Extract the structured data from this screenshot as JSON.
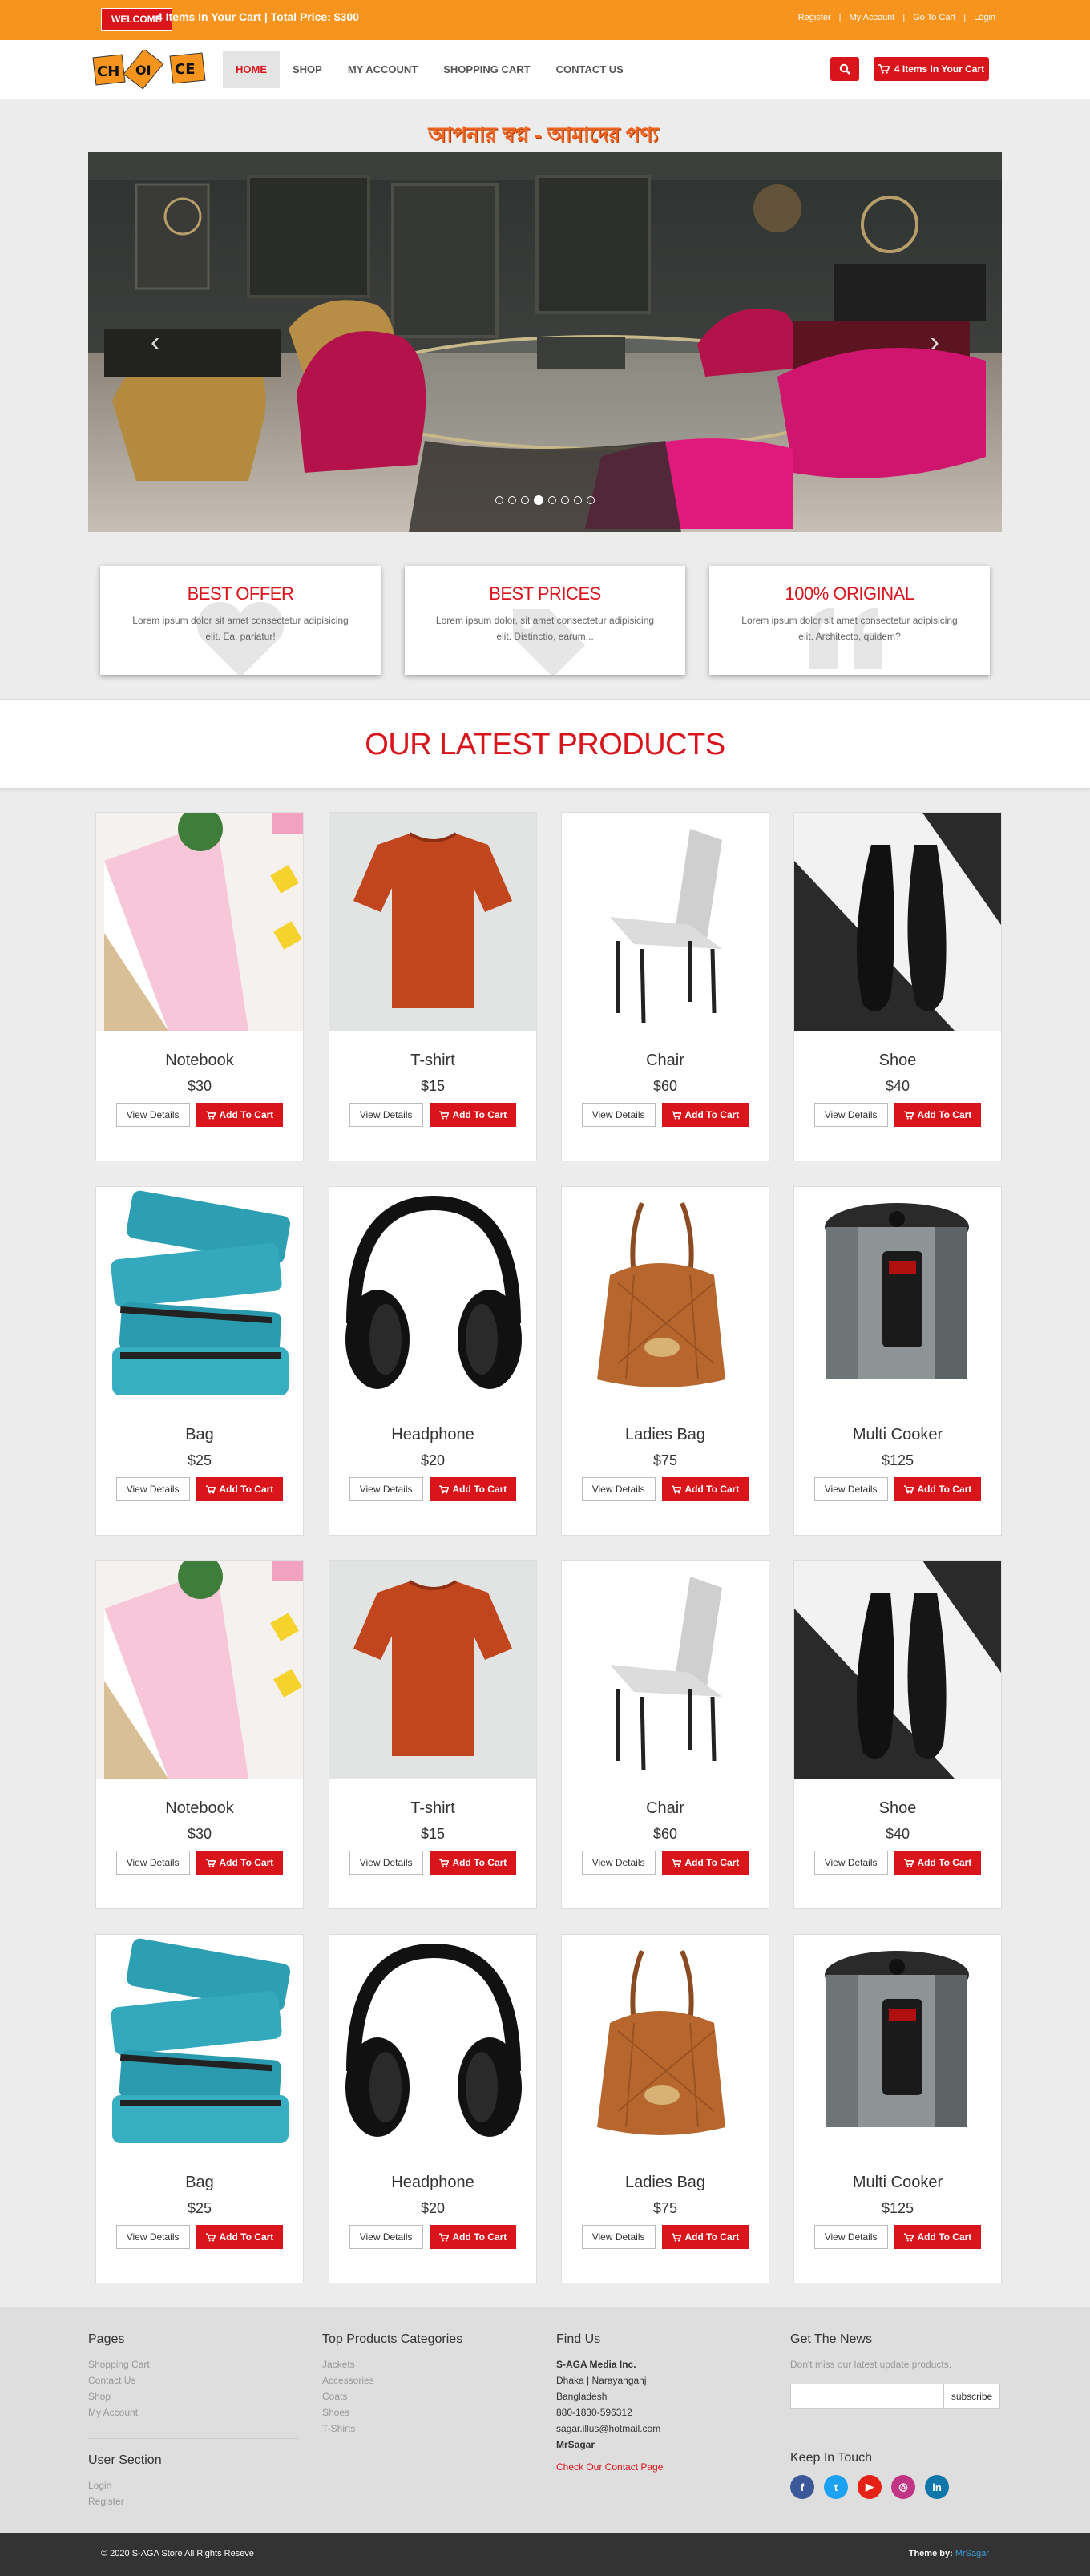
{
  "topbar": {
    "welcome": "WELCOME",
    "cart_info": "4 Items In Your Cart | Total Price: $300",
    "links": [
      "Register",
      "My Account",
      "Go To Cart",
      "Login"
    ]
  },
  "brand": {
    "logo_text": [
      "CH",
      "OI",
      "CE"
    ]
  },
  "nav": {
    "items": [
      "HOME",
      "SHOP",
      "MY ACCOUNT",
      "SHOPPING CART",
      "CONTACT US"
    ],
    "active": "HOME",
    "cart_button": "4 Items In Your Cart"
  },
  "hero": {
    "tagline": "আপনার স্বপ্ন - আমাদের পণ্য",
    "dots_count": 8,
    "active_dot": 3
  },
  "features": [
    {
      "title": "BEST OFFER",
      "text": "Lorem ipsum dolor sit amet consectetur adipisicing elit. Ea, pariatur!"
    },
    {
      "title": "BEST PRICES",
      "text": "Lorem ipsum dolor, sit amet consectetur adipisicing elit. Distinctio, earum..."
    },
    {
      "title": "100% ORIGINAL",
      "text": "Lorem ipsum dolor sit amet consectetur adipisicing elit. Architecto, quidem?"
    }
  ],
  "section_title": "OUR LATEST PRODUCTS",
  "product_buttons": {
    "view": "View Details",
    "add": "Add To Cart"
  },
  "products": [
    {
      "name": "Notebook",
      "price": "$30",
      "kind": "notebook"
    },
    {
      "name": "T-shirt",
      "price": "$15",
      "kind": "tshirt"
    },
    {
      "name": "Chair",
      "price": "$60",
      "kind": "chair"
    },
    {
      "name": "Shoe",
      "price": "$40",
      "kind": "shoe"
    },
    {
      "name": "Bag",
      "price": "$25",
      "kind": "bag"
    },
    {
      "name": "Headphone",
      "price": "$20",
      "kind": "headphone"
    },
    {
      "name": "Ladies Bag",
      "price": "$75",
      "kind": "ladiesbag"
    },
    {
      "name": "Multi Cooker",
      "price": "$125",
      "kind": "cooker"
    },
    {
      "name": "Notebook",
      "price": "$30",
      "kind": "notebook"
    },
    {
      "name": "T-shirt",
      "price": "$15",
      "kind": "tshirt"
    },
    {
      "name": "Chair",
      "price": "$60",
      "kind": "chair"
    },
    {
      "name": "Shoe",
      "price": "$40",
      "kind": "shoe"
    },
    {
      "name": "Bag",
      "price": "$25",
      "kind": "bag"
    },
    {
      "name": "Headphone",
      "price": "$20",
      "kind": "headphone"
    },
    {
      "name": "Ladies Bag",
      "price": "$75",
      "kind": "ladiesbag"
    },
    {
      "name": "Multi Cooker",
      "price": "$125",
      "kind": "cooker"
    }
  ],
  "footer": {
    "pages": {
      "title": "Pages",
      "links": [
        "Shopping Cart",
        "Contact Us",
        "Shop",
        "My Account"
      ]
    },
    "user": {
      "title": "User Section",
      "links": [
        "Login",
        "Register"
      ]
    },
    "categories": {
      "title": "Top Products Categories",
      "links": [
        "Jackets",
        "Accessories",
        "Coats",
        "Shoes",
        "T-Shirts"
      ]
    },
    "find": {
      "title": "Find Us",
      "company": "S-AGA Media Inc.",
      "lines": [
        "Dhaka | Narayanganj",
        "Bangladesh",
        "880-1830-596312",
        "sagar.illus@hotmail.com"
      ],
      "name": "MrSagar",
      "contact_link": "Check Our Contact Page"
    },
    "news": {
      "title": "Get The News",
      "text": "Don't miss our latest update products.",
      "button": "subscribe"
    },
    "touch": {
      "title": "Keep In Touch"
    }
  },
  "bottom": {
    "copyright": "© 2020 S-AGA Store All Rights Reseve",
    "theme_label": "Theme by:",
    "theme_author": "MrSagar"
  },
  "colors": {
    "orange": "#f7941d",
    "red": "#d9141b"
  }
}
